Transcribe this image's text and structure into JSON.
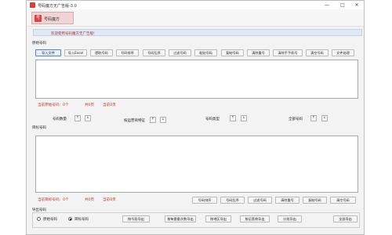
{
  "window": {
    "title": "号码魔方无广告版-3.0",
    "controls": [
      "—",
      "□",
      "✕"
    ]
  },
  "logo": {
    "mark": "号",
    "text": "号码魔方"
  },
  "welcome": "欢迎使用号码魔方无广告版!",
  "source": {
    "label": "原始号码",
    "buttons": [
      "导入文件",
      "导入Excel",
      "提取号码",
      "号码排序",
      "号码乱序",
      "过滤号码",
      "粘贴号码",
      "复制号码",
      "清除重号",
      "清除手手机号",
      "清空号码",
      "文件处理"
    ],
    "status": {
      "count": "当前原始号码：0个",
      "total": "共0页",
      "current": "当前0页"
    }
  },
  "filters": [
    {
      "label": "号码数量"
    },
    {
      "label": "按运营商特征"
    },
    {
      "label": "号码类型"
    },
    {
      "label": "全部号码"
    }
  ],
  "target": {
    "label": "目标号码",
    "status": {
      "count": "当前目标号码：0个",
      "total": "共0页",
      "current": "当前0页"
    },
    "buttons": [
      "号码排序",
      "号码乱序",
      "过滤号码",
      "清除重号",
      "复制号码",
      "清空号码"
    ]
  },
  "export": {
    "label": "导出号码",
    "radios": [
      {
        "label": "原始号码",
        "selected": false
      },
      {
        "label": "目标号码",
        "selected": true
      }
    ],
    "buttons": [
      "按号段导出",
      "按每量重次数导出",
      "按地区导出",
      "按运营商导出",
      "分批导出",
      "全部导出"
    ]
  },
  "arrows": {
    "up": "↑",
    "down": "↓"
  },
  "colors": {
    "accent": "#c0392b",
    "welcome_bg": "#dfe9f5",
    "logo_bg": "#f2d3d3"
  }
}
